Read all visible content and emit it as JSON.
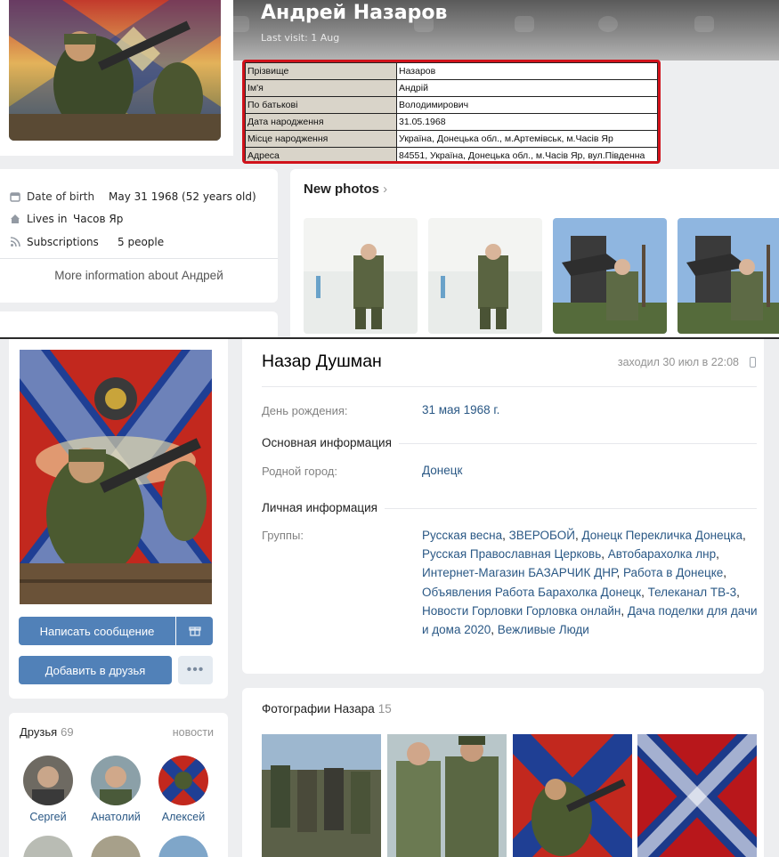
{
  "top_profile": {
    "name": "Андрей Назаров",
    "last_visit": "Last visit: 1 Aug",
    "registry": [
      {
        "key": "Прізвище",
        "value": "Назаров"
      },
      {
        "key": "Ім'я",
        "value": "Андрій"
      },
      {
        "key": "По батькові",
        "value": "Володимирович"
      },
      {
        "key": "Дата народження",
        "value": "31.05.1968"
      },
      {
        "key": "Місце народження",
        "value": "Україна, Донецька обл., м.Артемівськ, м.Часів Яр"
      },
      {
        "key": "Адреса",
        "value": "84551, Україна, Донецька обл., м.Часів Яр, вул.Південна"
      }
    ],
    "info": {
      "dob_label": "Date of birth",
      "dob_value": "May 31 1968 (52 years old)",
      "lives_label": "Lives in",
      "lives_value": "Часов Яр",
      "subs_label": "Subscriptions",
      "subs_value": "5 people"
    },
    "more_info": "More information about Андрей",
    "new_photos": "New photos",
    "chevron": "›"
  },
  "bottom_profile": {
    "name": "Назар Душман",
    "last_visit": "заходил 30 июл в 22:08",
    "birthday_label": "День рождения:",
    "birthday_value": "31 мая 1968 г.",
    "section_main": "Основная информация",
    "hometown_label": "Родной город:",
    "hometown_value": "Донецк",
    "section_personal": "Личная информация",
    "groups_label": "Группы:",
    "groups": [
      "Русская весна",
      "ЗВЕРОБОЙ",
      "Донецк Перекличка Донецка",
      "Русская Православная Церковь",
      "Автобарахолка лнр",
      "Интернет-Магазин БАЗАРЧИК ДНР",
      "Работа в Донецке",
      "Объявления Работа Барахолка Донецк",
      "Телеканал ТВ-3",
      "Новости Горловки Горловка онлайн",
      "Дача поделки для дачи и дома 2020",
      "Вежливые Люди"
    ],
    "buttons": {
      "message": "Написать сообщение",
      "add_friend": "Добавить в друзья",
      "more": "•••"
    },
    "friends": {
      "title": "Друзья",
      "count": "69",
      "news_link": "новости",
      "items": [
        {
          "name": "Сергей"
        },
        {
          "name": "Анатолий"
        },
        {
          "name": "Алексей"
        }
      ]
    },
    "photos": {
      "title": "Фотографии Назара",
      "count": "15"
    }
  },
  "colors": {
    "vk_blue": "#5181b8",
    "link": "#2a5885",
    "highlight_red": "#d0121b",
    "page_bg": "#edeef0"
  },
  "icons": [
    "calendar-icon",
    "home-icon",
    "rss-icon",
    "gift-icon",
    "phone-icon",
    "chevron-right-icon"
  ]
}
